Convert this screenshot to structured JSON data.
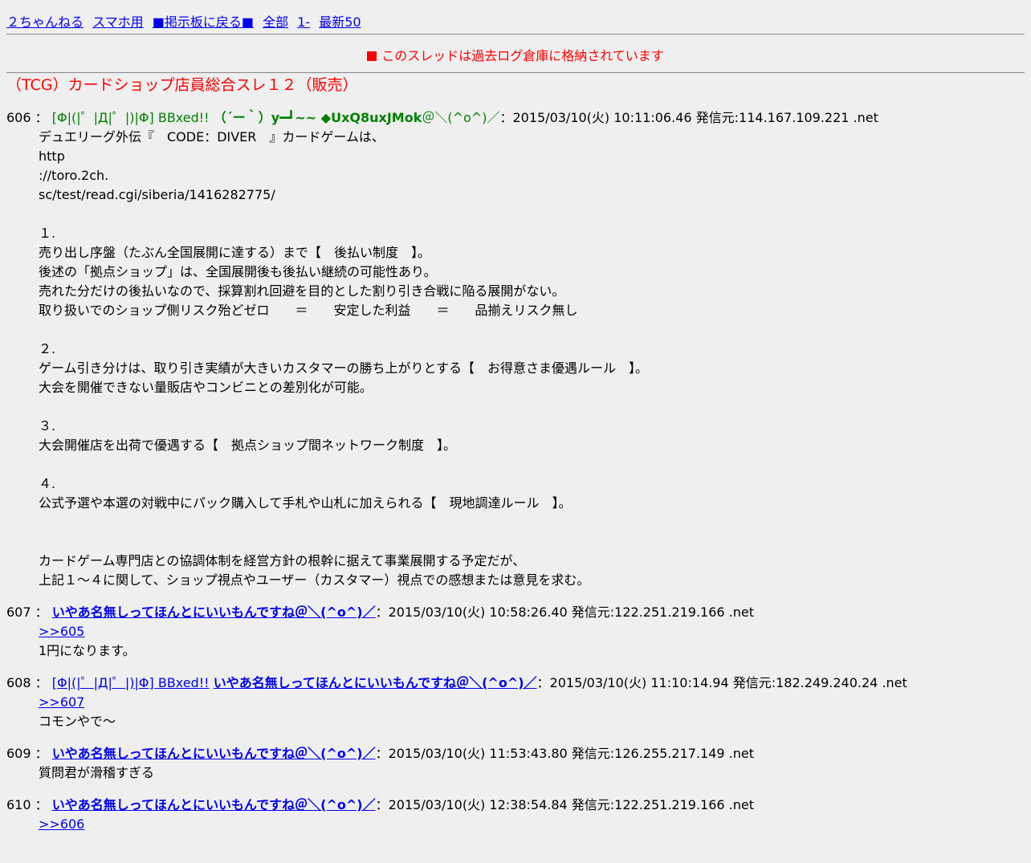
{
  "nav": {
    "site": "２ちゃんねる",
    "mobile": "スマホ用",
    "back": "■掲示板に戻る■",
    "all": "全部",
    "first": "1-",
    "latest": "最新50"
  },
  "notice": "このスレッドは過去ログ倉庫に格納されています",
  "thread_title": "（TCG）カードショップ店員総合スレ１２（販売）",
  "posts": {
    "p606": {
      "num": "606",
      "sep": "：",
      "cap": "[Φ|(|゜|Д|゜|)|Φ] BBxed!!",
      "name": "（´ー｀）y━┛~~ ◆UxQ8uxJMok",
      "suffix": "＠＼(^o^)／",
      "meta": "：2015/03/10(火) 10:11:06.46 発信元:114.167.109.221 .net",
      "lines": [
        "デュエリーグ外伝『　CODE：DIVER　』カードゲームは、",
        "http",
        "://toro.2ch.",
        "sc/test/read.cgi/siberia/1416282775/",
        "",
        "１.",
        "売り出し序盤（たぶん全国展開に達する）まで【　後払い制度　】。",
        "後述の「拠点ショップ」は、全国展開後も後払い継続の可能性あり。",
        "売れた分だけの後払いなので、採算割れ回避を目的とした割り引き合戦に陥る展開がない。",
        "取り扱いでのショップ側リスク殆どゼロ　　＝　　安定した利益　　＝　　品揃えリスク無し",
        "",
        "２.",
        "ゲーム引き分けは、取り引き実績が大きいカスタマーの勝ち上がりとする【　お得意さま優遇ルール　】。",
        "大会を開催できない量販店やコンビニとの差別化が可能。",
        "",
        "３.",
        "大会開催店を出荷で優遇する【　拠点ショップ間ネットワーク制度　】。",
        "",
        "４.",
        "公式予選や本選の対戦中にパック購入して手札や山札に加えられる【　現地調達ルール　】。",
        "",
        "",
        "カードゲーム専門店との協調体制を経営方針の根幹に据えて事業展開する予定だが、",
        "上記１～４に関して、ショップ視点やユーザー（カスタマー）視点での感想または意見を求む。"
      ]
    },
    "p607": {
      "num": "607",
      "sep": "：",
      "name": "いやあ名無しってほんとにいいもんですね＠＼(^o^)／",
      "meta": "：2015/03/10(火) 10:58:26.40 発信元:122.251.219.166 .net",
      "reply": ">>605",
      "lines": [
        "1円になります。"
      ]
    },
    "p608": {
      "num": "608",
      "sep": "：",
      "cap": "[Φ|(|゜|Д|゜|)|Φ] BBxed!!",
      "name": "いやあ名無しってほんとにいいもんですね＠＼(^o^)／",
      "meta": "：2015/03/10(火) 11:10:14.94 発信元:182.249.240.24 .net",
      "reply": ">>607",
      "lines": [
        "コモンやで～"
      ]
    },
    "p609": {
      "num": "609",
      "sep": "：",
      "name": "いやあ名無しってほんとにいいもんですね＠＼(^o^)／",
      "meta": "：2015/03/10(火) 11:53:43.80 発信元:126.255.217.149 .net",
      "lines": [
        "質問君が滑稽すぎる"
      ]
    },
    "p610": {
      "num": "610",
      "sep": "：",
      "name": "いやあ名無しってほんとにいいもんですね＠＼(^o^)／",
      "meta": "：2015/03/10(火) 12:38:54.84 発信元:122.251.219.166 .net",
      "reply": ">>606"
    }
  },
  "colors": {
    "background": "#efefef",
    "link": "#0000ee",
    "notice": "#ff0000",
    "name_green": "#008000"
  }
}
